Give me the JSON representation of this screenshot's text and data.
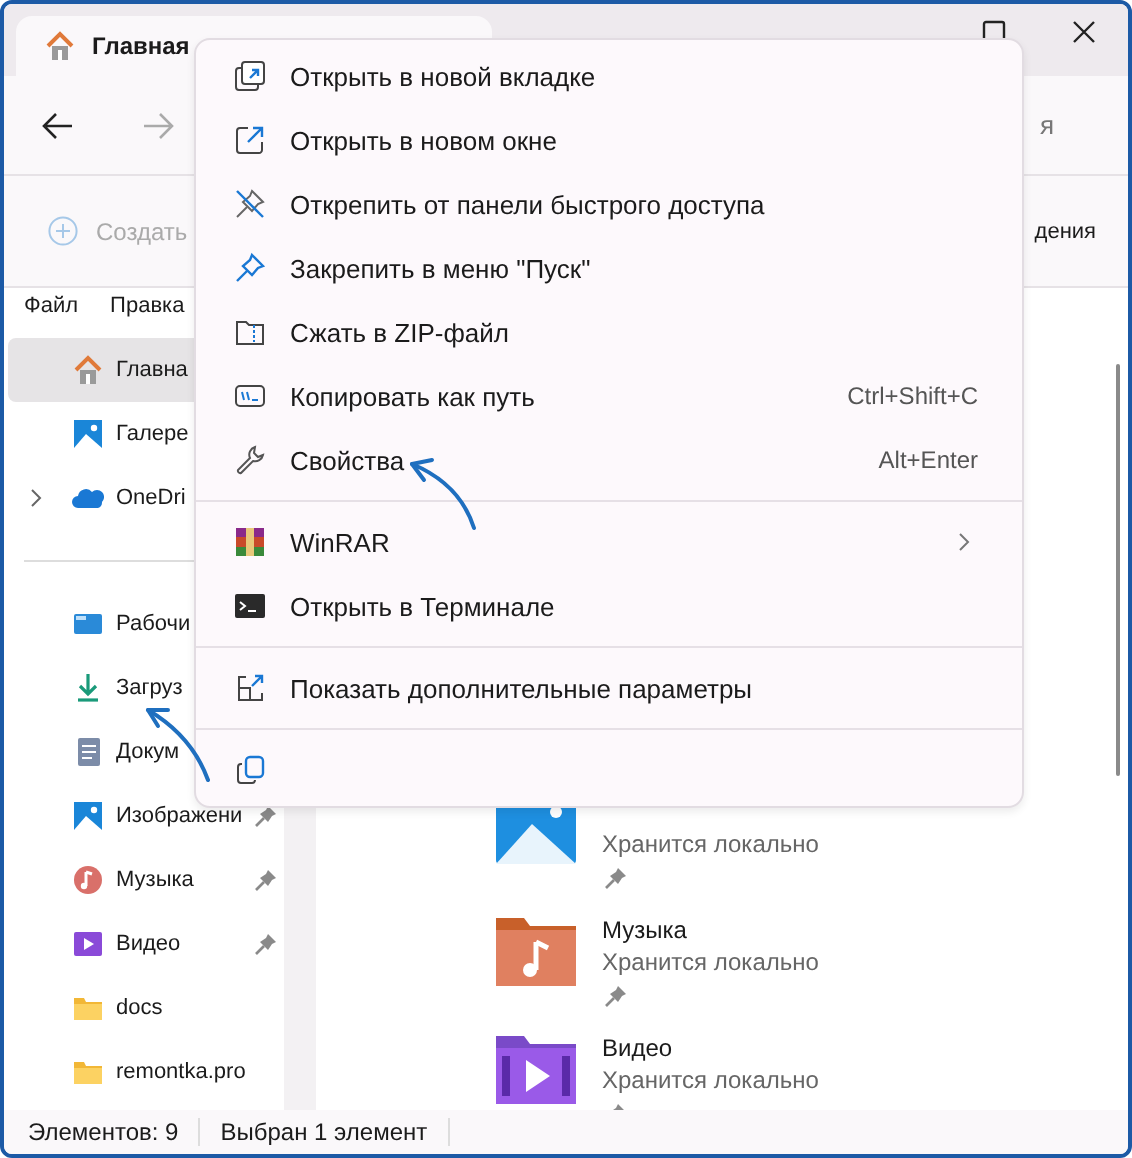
{
  "window": {
    "tab_title": "Главная"
  },
  "nav": {
    "search_fragment": "я"
  },
  "toolbar": {
    "create": "Создать",
    "right_fragment": "дения"
  },
  "menubar": [
    "Файл",
    "Правка"
  ],
  "sidebar": {
    "top_items": [
      {
        "label": "Главна",
        "selected": true,
        "expandable": false
      },
      {
        "label": "Галере",
        "selected": false,
        "expandable": false
      },
      {
        "label": "OneDri",
        "selected": false,
        "expandable": true
      }
    ],
    "quick_access": [
      {
        "label": "Рабочи",
        "selected": false,
        "pinned": false
      },
      {
        "label": "Загруз",
        "selected": false,
        "pinned": false
      },
      {
        "label": "Докум",
        "selected": false,
        "pinned": false
      },
      {
        "label": "Изображени",
        "selected": false,
        "pinned": true
      },
      {
        "label": "Музыка",
        "selected": false,
        "pinned": true
      },
      {
        "label": "Видео",
        "selected": false,
        "pinned": true
      },
      {
        "label": "docs",
        "selected": false,
        "pinned": false
      },
      {
        "label": "remontka.pro",
        "selected": false,
        "pinned": false
      }
    ]
  },
  "content": {
    "items": [
      {
        "subtitle": "Хранится локально",
        "pinned": true
      },
      {
        "title": "Музыка",
        "subtitle": "Хранится локально",
        "pinned": true
      },
      {
        "title": "Видео",
        "subtitle": "Хранится локально",
        "pinned": true
      }
    ]
  },
  "context_menu": {
    "items": [
      {
        "kind": "item",
        "label": "Открыть в новой вкладке"
      },
      {
        "kind": "item",
        "label": "Открыть в новом окне"
      },
      {
        "kind": "item",
        "label": "Открепить от панели быстрого доступа"
      },
      {
        "kind": "item",
        "label": "Закрепить в меню \"Пуск\""
      },
      {
        "kind": "item",
        "label": "Сжать в ZIP-файл"
      },
      {
        "kind": "item",
        "label": "Копировать как путь",
        "shortcut": "Ctrl+Shift+C"
      },
      {
        "kind": "item",
        "label": "Свойства",
        "shortcut": "Alt+Enter"
      },
      {
        "kind": "separator"
      },
      {
        "kind": "item",
        "label": "WinRAR",
        "submenu": true
      },
      {
        "kind": "item",
        "label": "Открыть в Терминале"
      },
      {
        "kind": "separator"
      },
      {
        "kind": "item",
        "label": "Показать дополнительные параметры"
      },
      {
        "kind": "separator"
      },
      {
        "kind": "icon_row"
      }
    ]
  },
  "status_bar": [
    "Элементов: 9",
    "Выбран 1 элемент"
  ]
}
